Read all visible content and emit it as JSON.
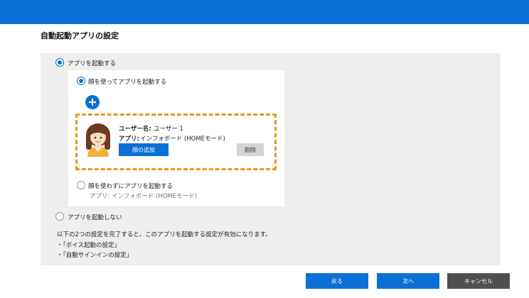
{
  "page": {
    "title": "自動起動アプリの設定"
  },
  "options": {
    "launch_app": {
      "label": "アプリを起動する",
      "selected": true
    },
    "with_face": {
      "label": "顔を使ってアプリを起動する",
      "selected": true
    },
    "without_face": {
      "label": "顔を使わずにアプリを起動する",
      "app_line": "アプリ: インフォボード (HOMEモード)",
      "selected": false
    },
    "no_launch": {
      "label": "アプリを起動しない",
      "selected": false
    }
  },
  "user_card": {
    "name_label": "ユーザー名:",
    "name_value": "ユーザー 1",
    "app_label": "アプリ:",
    "app_value": "インフォボード (HOMEモード)",
    "add_face_label": "顔の追加",
    "delete_label": "削除"
  },
  "notes": {
    "intro": "以下の2つの設定を完了すると、このアプリを起動する設定が有効になります。",
    "items": [
      "・「ボイス起動の設定」",
      "・「自動サインインの設定」"
    ]
  },
  "footer": {
    "back_label": "戻る",
    "next_label": "次へ",
    "cancel_label": "キャンセル"
  },
  "colors": {
    "accent": "#0b70d6",
    "highlight_border": "#e8981c",
    "panel_bg": "#eeeeee",
    "cancel_bg": "#505050"
  },
  "icons": {
    "add": "plus-circle-icon",
    "avatar": "user-avatar-illustration"
  }
}
